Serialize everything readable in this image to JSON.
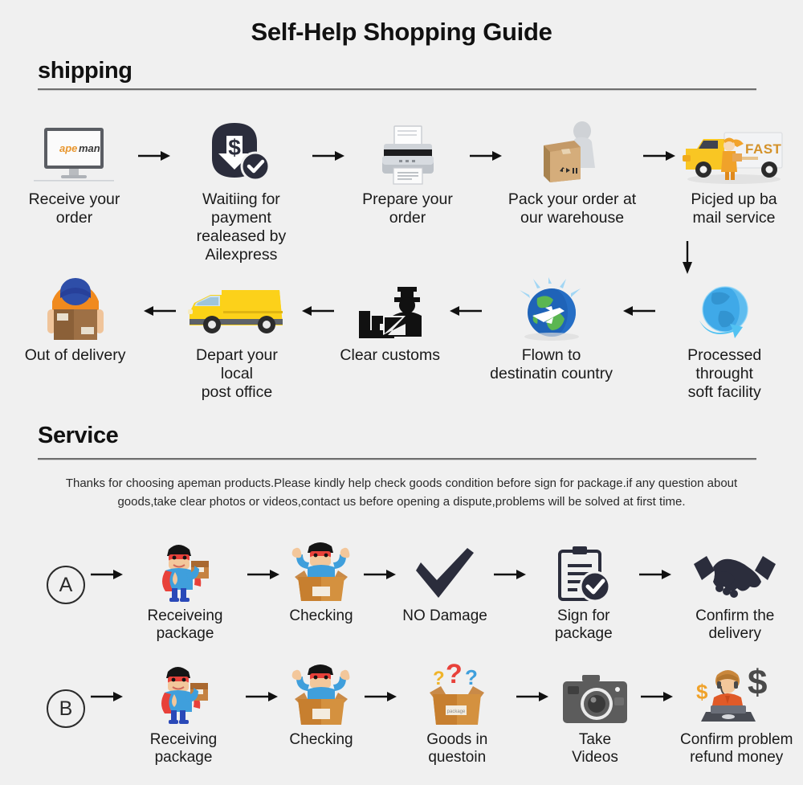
{
  "document": {
    "title": "Self-Help Shopping Guide",
    "background_color": "#f0f0f0",
    "text_color": "#1a1a1a"
  },
  "shipping": {
    "heading": "shipping",
    "row1": [
      {
        "label": "Receive your order",
        "icon": "monitor-apeman-icon"
      },
      {
        "label": "Waitiing for payment\nrealeased by Ailexpress",
        "icon": "payment-dollar-download-icon"
      },
      {
        "label": "Prepare your order",
        "icon": "printer-icon"
      },
      {
        "label": "Pack your order at\nour warehouse",
        "icon": "worker-packing-box-icon"
      },
      {
        "label": "Picjed up ba\nmail service",
        "icon": "fast-delivery-truck-icon"
      }
    ],
    "row2": [
      {
        "label": "Out of delivery",
        "icon": "courier-carrying-box-icon"
      },
      {
        "label": "Depart your local\npost office",
        "icon": "yellow-van-icon"
      },
      {
        "label": "Clear customs",
        "icon": "customs-officer-icon"
      },
      {
        "label": "Flown to\ndestinatin country",
        "icon": "globe-airplane-icon"
      },
      {
        "label": "Processed throught\nsoft facility",
        "icon": "globe-arrow-icon"
      }
    ],
    "monitor_logo": {
      "part1": "ape",
      "part2": "man"
    },
    "truck_badge": "FAST"
  },
  "service": {
    "heading": "Service",
    "paragraph": "Thanks for choosing apeman products.Please kindly help check goods condition before sign for package.if any question about goods,take clear photos or videos,contact us before opening a dispute,problems will be solved at first time.",
    "rowA": {
      "badge": "A",
      "steps": [
        {
          "label": "Receiveing package",
          "icon": "hero-holding-package-icon"
        },
        {
          "label": "Checking",
          "icon": "hero-in-open-box-icon"
        },
        {
          "label": "NO Damage",
          "icon": "checkmark-icon"
        },
        {
          "label": "Sign for package",
          "icon": "clipboard-check-icon"
        },
        {
          "label": "Confirm the delivery",
          "icon": "handshake-icon"
        }
      ]
    },
    "rowB": {
      "badge": "B",
      "steps": [
        {
          "label": "Receiving package",
          "icon": "hero-holding-package-icon"
        },
        {
          "label": "Checking",
          "icon": "hero-in-open-box-icon"
        },
        {
          "label": "Goods in questoin",
          "icon": "box-question-marks-icon"
        },
        {
          "label": "Take Videos",
          "icon": "camera-icon"
        },
        {
          "label": "Confirm problem\nrefund money",
          "icon": "support-agent-dollar-icon"
        }
      ]
    }
  },
  "colors": {
    "accent_orange": "#f0a22a",
    "truck_yellow": "#fcc10a",
    "dark_navy": "#2b2d3c",
    "box_tan": "#cfa878",
    "hero_red": "#e8403a",
    "hero_blue": "#3a9ad9",
    "globe_blue": "#2f7fd0",
    "rule_gray": "#6e6e6e"
  }
}
